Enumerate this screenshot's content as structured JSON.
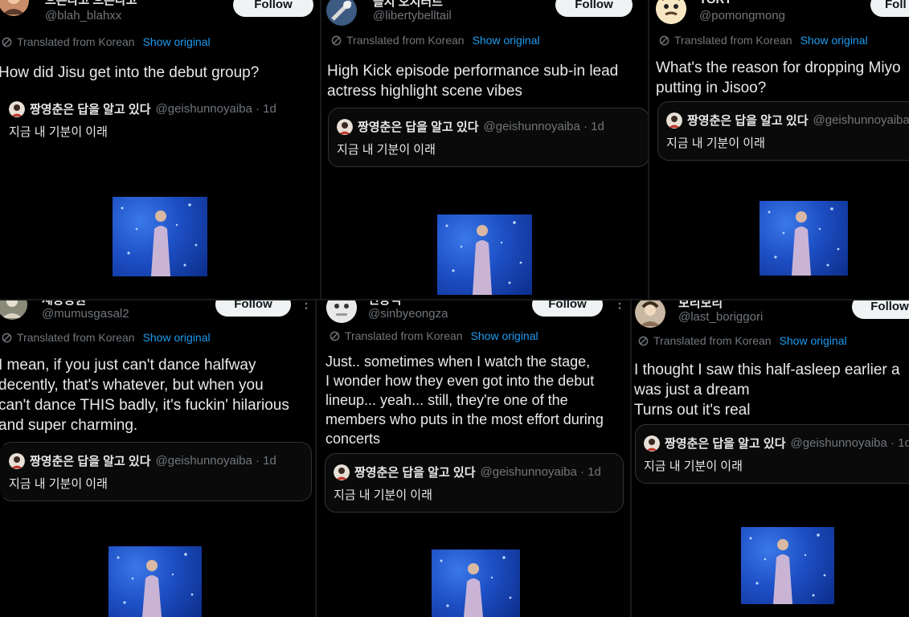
{
  "translated_label": "Translated from Korean",
  "show_original_label": "Show original",
  "follow_label": "Follow",
  "follow_label_cut": "Foll",
  "more_label": "⋮",
  "quoted": {
    "name": "짱영춘은 답을 알고 있다",
    "handle": "@geishunnoyaiba",
    "handle_time": "@geishunnoyaiba · 1d",
    "text": "지금 내 기분이 이래"
  },
  "panels": [
    {
      "name": "으른다고 으른다고",
      "handle": "@blah_blahxx",
      "text": "How did Jisu get into the debut group?"
    },
    {
      "name": "블지 오지터르",
      "handle": "@libertybelltail",
      "text": "High Kick episode performance sub-in lead\nactress highlight scene vibes"
    },
    {
      "name": "TORY",
      "handle": "@pomongmong",
      "text": "What's the reason for dropping Miyo\nputting in Jisoo?"
    },
    {
      "name": "세종공원",
      "handle": "@mumusgasal2",
      "text": "I mean, if you just can't dance halfway\ndecently, that's whatever, but when you\ncan't dance THIS badly, it's fuckin' hilarious\nand super charming."
    },
    {
      "name": "민동석",
      "handle": "@sinbyeongza",
      "text": "Just.. sometimes when I watch the stage,\nI wonder how they even got into the debut\nlineup... yeah... still, they're one of the\nmembers who puts in the most effort during\nconcerts"
    },
    {
      "name": "보리보리",
      "handle": "@last_boriggori",
      "text": "I thought I saw this half-asleep earlier a\nwas just a dream\nTurns out it's real"
    }
  ],
  "colors": {
    "background": "#000000",
    "text": "#e7e9ea",
    "muted": "#71767b",
    "link": "#1d9bf0",
    "video_blue": "#1d4fc4"
  }
}
